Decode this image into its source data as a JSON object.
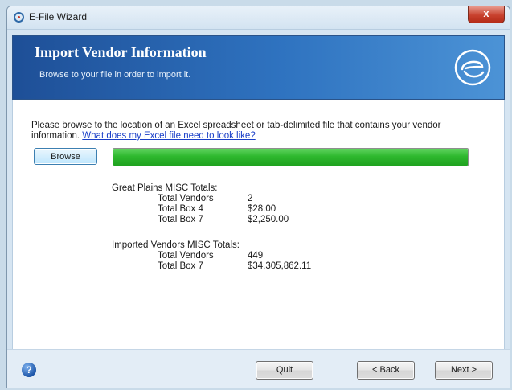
{
  "window": {
    "title": "E-File Wizard",
    "close_label": "x"
  },
  "banner": {
    "title": "Import Vendor Information",
    "subtitle": "Browse to your file in order to import it."
  },
  "content": {
    "instructions_text": "Please browse to the location of an Excel spreadsheet or tab-delimited file that contains your vendor information.",
    "help_link": "What does my Excel file need to look like?",
    "browse_label": "Browse",
    "progress_fraction": 1.0,
    "great_plains": {
      "heading": "Great Plains MISC Totals:",
      "rows": [
        {
          "label": "Total Vendors",
          "value": "2"
        },
        {
          "label": "Total Box 4",
          "value": "$28.00"
        },
        {
          "label": "Total Box 7",
          "value": "$2,250.00"
        }
      ]
    },
    "imported": {
      "heading": "Imported Vendors MISC Totals:",
      "rows": [
        {
          "label": "Total Vendors",
          "value": "449"
        },
        {
          "label": "Total Box 7",
          "value": "$34,305,862.11"
        }
      ]
    }
  },
  "footer": {
    "help_icon_glyph": "?",
    "quit_label": "Quit",
    "back_label": "< Back",
    "next_label": "Next >"
  },
  "colors": {
    "banner_blue": "#2f73c0",
    "progress_green": "#2eb82e",
    "link_blue": "#1a3fc8",
    "close_red": "#c8412e"
  }
}
